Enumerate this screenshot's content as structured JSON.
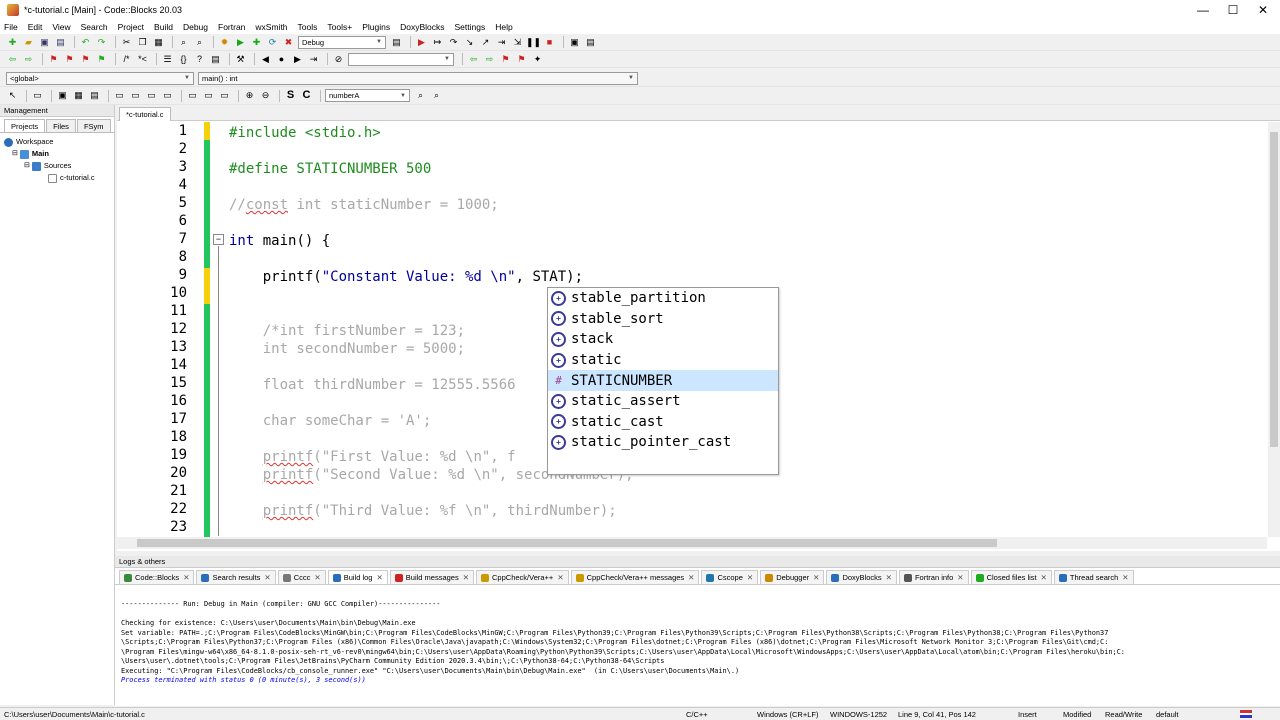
{
  "window": {
    "title": "*c-tutorial.c [Main] - Code::Blocks 20.03"
  },
  "menu": [
    "File",
    "Edit",
    "View",
    "Search",
    "Project",
    "Build",
    "Debug",
    "Fortran",
    "wxSmith",
    "Tools",
    "Tools+",
    "Plugins",
    "DoxyBlocks",
    "Settings",
    "Help"
  ],
  "toolbar": {
    "build_target": "Debug",
    "scope": "<global>",
    "function": "main() : int",
    "search_text": "numberA"
  },
  "management": {
    "title": "Management",
    "tabs": [
      "Projects",
      "Files",
      "FSym"
    ],
    "tree": {
      "workspace": "Workspace",
      "project": "Main",
      "folder": "Sources",
      "file": "c-tutorial.c"
    }
  },
  "editor": {
    "tab": "*c-tutorial.c",
    "line_numbers": [
      "1",
      "2",
      "3",
      "4",
      "5",
      "6",
      "7",
      "8",
      "9",
      "10",
      "11",
      "12",
      "13",
      "14",
      "15",
      "16",
      "17",
      "18",
      "19",
      "20",
      "21",
      "22",
      "23"
    ],
    "code": {
      "l1": "#include <stdio.h>",
      "l3": "#define STATICNUMBER 500",
      "l5a": "//",
      "l5b": "const",
      "l5c": " int staticNumber = 1000;",
      "l7a": "int",
      "l7b": " main() {",
      "l9a": "    printf(",
      "l9b": "\"Constant Value: %d \\n\"",
      "l9c": ", STAT);",
      "l12": "    /*int firstNumber = 123;",
      "l13": "    int secondNumber = 5000;",
      "l15": "    float thirdNumber = 12555.5566",
      "l17": "    char someChar = 'A';",
      "l19a": "    ",
      "l19b": "printf",
      "l19c": "(\"First Value: %d \\n\", f",
      "l20a": "    ",
      "l20b": "printf",
      "l20c": "(\"Second Value: %d \\n\", secondNumber);",
      "l22a": "    ",
      "l22b": "printf",
      "l22c": "(\"Third Value: %f \\n\", thirdNumber);"
    }
  },
  "autocomplete": [
    {
      "label": "stable_partition",
      "kind": "func"
    },
    {
      "label": "stable_sort",
      "kind": "func"
    },
    {
      "label": "stack",
      "kind": "func"
    },
    {
      "label": "static",
      "kind": "func"
    },
    {
      "label": "STATICNUMBER",
      "kind": "macro",
      "selected": true
    },
    {
      "label": "static_assert",
      "kind": "func"
    },
    {
      "label": "static_cast",
      "kind": "func"
    },
    {
      "label": "static_pointer_cast",
      "kind": "func"
    }
  ],
  "logs": {
    "title": "Logs & others",
    "tabs": [
      "Code::Blocks",
      "Search results",
      "Cccc",
      "Build log",
      "Build messages",
      "CppCheck/Vera++",
      "CppCheck/Vera++ messages",
      "Cscope",
      "Debugger",
      "DoxyBlocks",
      "Fortran info",
      "Closed files list",
      "Thread search"
    ],
    "lines": [
      "-------------- Run: Debug in Main (compiler: GNU GCC Compiler)---------------",
      "",
      "Checking for existence: C:\\Users\\user\\Documents\\Main\\bin\\Debug\\Main.exe",
      "Set variable: PATH=.;C:\\Program Files\\CodeBlocks\\MinGW\\bin;C:\\Program Files\\CodeBlocks\\MinGW;C:\\Program Files\\Python39;C:\\Program Files\\Python39\\Scripts;C:\\Program Files\\Python38\\Scripts;C:\\Program Files\\Python38;C:\\Program Files\\Python37",
      "\\Scripts;C:\\Program Files\\Python37;C:\\Program Files (x86)\\Common Files\\Oracle\\Java\\javapath;C:\\Windows\\System32;C:\\Program Files\\dotnet;C:\\Program Files (x86)\\dotnet;C:\\Program Files\\Microsoft Network Monitor 3;C:\\Program Files\\Git\\cmd;C:",
      "\\Program Files\\mingw-w64\\x86_64-8.1.0-posix-seh-rt_v6-rev0\\mingw64\\bin;C:\\Users\\user\\AppData\\Roaming\\Python\\Python39\\Scripts;C:\\Users\\user\\AppData\\Local\\Microsoft\\WindowsApps;C:\\Users\\user\\AppData\\Local\\atom\\bin;C:\\Program Files\\heroku\\bin;C:",
      "\\Users\\user\\.dotnet\\tools;C:\\Program Files\\JetBrains\\PyCharm Community Edition 2020.3.4\\bin;\\;C:\\Python38-64;C:\\Python38-64\\Scripts",
      "Executing: \"C:\\Program Files\\CodeBlocks/cb_console_runner.exe\" \"C:\\Users\\user\\Documents\\Main\\bin\\Debug\\Main.exe\"  (in C:\\Users\\user\\Documents\\Main\\.)"
    ],
    "final": "Process terminated with status 0 (0 minute(s), 3 second(s))"
  },
  "status": {
    "path": "C:\\Users\\user\\Documents\\Main\\c-tutorial.c",
    "lang": "C/C++",
    "eol": "Windows (CR+LF)",
    "encoding": "WINDOWS-1252",
    "position": "Line 9, Col 41, Pos 142",
    "mode": "Insert",
    "modified": "Modified",
    "rw": "Read/Write",
    "profile": "default"
  }
}
